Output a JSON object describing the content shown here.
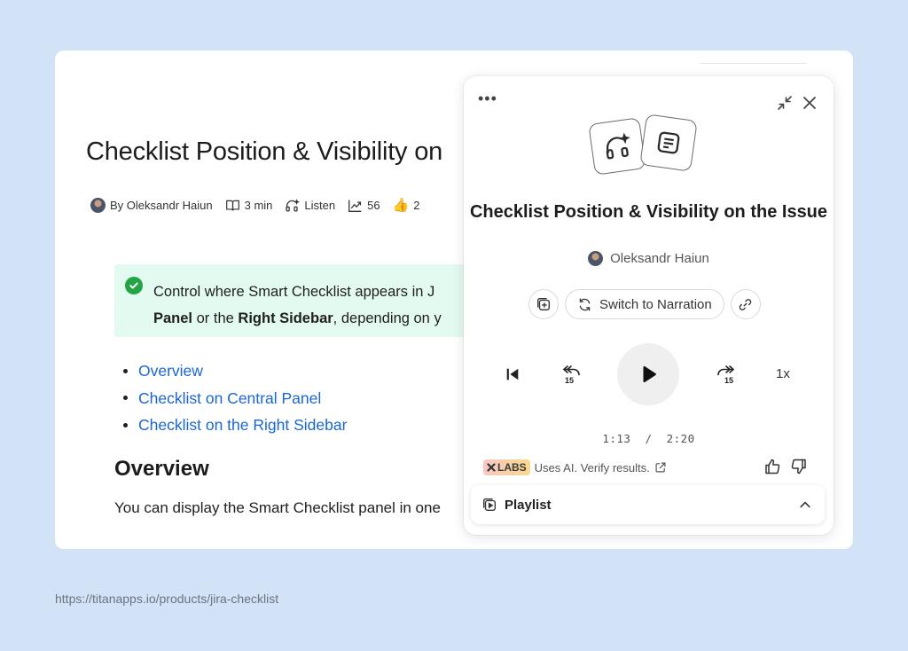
{
  "article": {
    "title": "Checklist Position & Visibility on",
    "meta": {
      "author": "By Oleksandr Haiun",
      "read_time": "3 min",
      "listen": "Listen",
      "views": "56",
      "likes": "2"
    },
    "callout": {
      "line1_prefix": "Control where Smart Checklist appears in J",
      "line2_bold1": "Panel",
      "line2_mid": " or the ",
      "line2_bold2": "Right Sidebar",
      "line2_suffix": ", depending on y"
    },
    "toc": [
      "Overview",
      "Checklist on Central Panel",
      "Checklist on the Right Sidebar"
    ],
    "heading": "Overview",
    "paragraph": "You can display the Smart Checklist panel in one"
  },
  "player": {
    "title": "Checklist Position & Visibility on the Issue",
    "author": "Oleksandr Haiun",
    "switch_label": "Switch to Narration",
    "speed": "1x",
    "time_current": "1:13",
    "time_sep": "/",
    "time_total": "2:20",
    "labs_badge": "LABS",
    "labs_text": "Uses AI. Verify results.",
    "playlist_label": "Playlist",
    "skip_seconds": "15"
  },
  "url": "https://titanapps.io/products/jira-checklist",
  "colors": {
    "background": "#d3e3f7",
    "link": "#1a66d6",
    "callout_bg": "#e3faf0",
    "check": "#22a447"
  }
}
